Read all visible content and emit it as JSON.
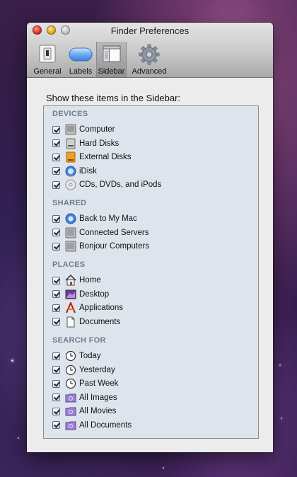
{
  "window": {
    "title": "Finder Preferences"
  },
  "toolbar": {
    "buttons": [
      {
        "label": "General",
        "icon": "general-switch-icon",
        "selected": false
      },
      {
        "label": "Labels",
        "icon": "labels-pill-icon",
        "selected": false
      },
      {
        "label": "Sidebar",
        "icon": "sidebar-window-icon",
        "selected": true
      },
      {
        "label": "Advanced",
        "icon": "gear-icon",
        "selected": false
      }
    ]
  },
  "main": {
    "heading": "Show these items in the Sidebar:",
    "sections": [
      {
        "title": "DEVICES",
        "items": [
          {
            "label": "Computer",
            "checked": true,
            "icon": "computer-icon"
          },
          {
            "label": "Hard Disks",
            "checked": true,
            "icon": "hard-disk-icon"
          },
          {
            "label": "External Disks",
            "checked": true,
            "icon": "external-disk-icon"
          },
          {
            "label": "iDisk",
            "checked": true,
            "icon": "idisk-icon"
          },
          {
            "label": "CDs, DVDs, and iPods",
            "checked": true,
            "icon": "cd-icon"
          }
        ]
      },
      {
        "title": "SHARED",
        "items": [
          {
            "label": "Back to My Mac",
            "checked": true,
            "icon": "back-to-my-mac-icon"
          },
          {
            "label": "Connected Servers",
            "checked": true,
            "icon": "server-icon"
          },
          {
            "label": "Bonjour Computers",
            "checked": true,
            "icon": "bonjour-computer-icon"
          }
        ]
      },
      {
        "title": "PLACES",
        "items": [
          {
            "label": "Home",
            "checked": true,
            "icon": "home-icon"
          },
          {
            "label": "Desktop",
            "checked": true,
            "icon": "desktop-icon"
          },
          {
            "label": "Applications",
            "checked": true,
            "icon": "applications-icon"
          },
          {
            "label": "Documents",
            "checked": true,
            "icon": "documents-icon"
          }
        ]
      },
      {
        "title": "SEARCH FOR",
        "items": [
          {
            "label": "Today",
            "checked": true,
            "icon": "clock-icon"
          },
          {
            "label": "Yesterday",
            "checked": true,
            "icon": "clock-icon"
          },
          {
            "label": "Past Week",
            "checked": true,
            "icon": "clock-icon"
          },
          {
            "label": "All Images",
            "checked": true,
            "icon": "smart-folder-icon"
          },
          {
            "label": "All Movies",
            "checked": true,
            "icon": "smart-folder-icon"
          },
          {
            "label": "All Documents",
            "checked": true,
            "icon": "smart-folder-icon"
          }
        ]
      }
    ]
  }
}
